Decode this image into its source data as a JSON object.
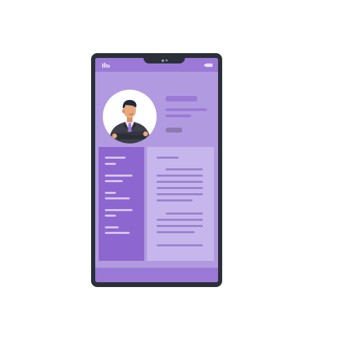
{
  "colors": {
    "phone_body": "#2b3038",
    "screen": "#b29ae0",
    "status_bar": "#9b79d6",
    "sidebar": "#8e66cf",
    "content_panel": "#c7b6ec",
    "avatar_bg": "#ffffff",
    "suit": "#3d3f4a",
    "tie": "#9b79d6"
  },
  "icons": {
    "signal": "signal-bars-icon",
    "battery": "battery-icon",
    "camera": "front-camera-icon"
  }
}
